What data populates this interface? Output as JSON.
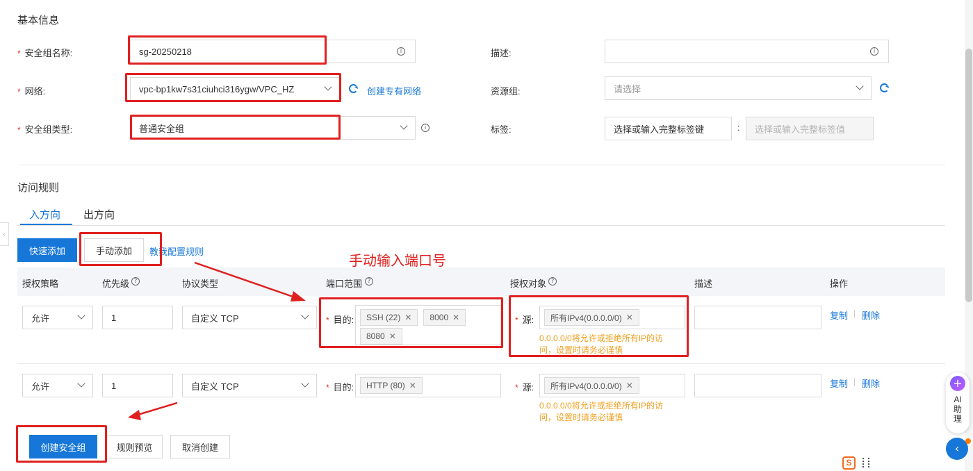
{
  "basic": {
    "title": "基本信息",
    "sg_name_label": "安全组名称:",
    "sg_name_value": "sg-20250218",
    "network_label": "网络:",
    "network_value": "vpc-bp1kw7s31ciuhci316ygw/VPC_HZ",
    "create_vpc_link": "创建专有网络",
    "sg_type_label": "安全组类型:",
    "sg_type_value": "普通安全组",
    "desc_label": "描述:",
    "resource_group_label": "资源组:",
    "resource_group_placeholder": "请选择",
    "tags_label": "标签:",
    "tag_key_placeholder": "选择或输入完整标签键",
    "tag_colon": ":",
    "tag_value_placeholder": "选择或输入完整标签值",
    "required_mark": "*"
  },
  "rules": {
    "title": "访问规则",
    "tabs": [
      "入方向",
      "出方向"
    ],
    "quick_add": "快速添加",
    "manual_add": "手动添加",
    "tutorial_link": "教我配置规则",
    "annotation": "手动输入端口号",
    "columns": [
      "授权策略",
      "优先级",
      "协议类型",
      "端口范围",
      "授权对象",
      "描述",
      "操作"
    ],
    "rows": [
      {
        "policy": "允许",
        "priority": "1",
        "protocol": "自定义 TCP",
        "dest_label": "目的:",
        "ports": [
          "SSH (22)",
          "8000",
          "8080"
        ],
        "src_label": "源:",
        "sources": [
          "所有IPv4(0.0.0.0/0)"
        ],
        "warning_line1": "0.0.0.0/0将允许或拒绝所有IP的访",
        "warning_line2": "问，设置时请务必谨慎",
        "copy": "复制",
        "delete": "删除"
      },
      {
        "policy": "允许",
        "priority": "1",
        "protocol": "自定义 TCP",
        "dest_label": "目的:",
        "ports": [
          "HTTP (80)"
        ],
        "src_label": "源:",
        "sources": [
          "所有IPv4(0.0.0.0/0)"
        ],
        "warning_line1": "0.0.0.0/0将允许或拒绝所有IP的访",
        "warning_line2": "问，设置时请务必谨慎",
        "copy": "复制",
        "delete": "删除"
      }
    ]
  },
  "footer": {
    "create_button": "创建安全组",
    "preview_button": "规则预览",
    "cancel_button": "取消创建"
  },
  "assistant": {
    "label_line1": "AI",
    "label_line2": "助",
    "label_line3": "理"
  },
  "colors": {
    "primary": "#1777d8",
    "required": "#e5331b",
    "annotation_red": "#e02020",
    "warning": "#f0a020"
  }
}
